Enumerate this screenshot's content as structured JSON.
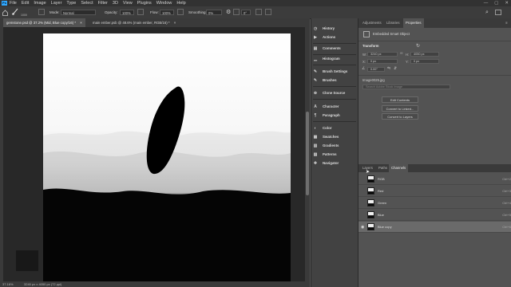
{
  "menubar": {
    "items": [
      "File",
      "Edit",
      "Image",
      "Layer",
      "Type",
      "Select",
      "Filter",
      "3D",
      "View",
      "Plugins",
      "Window",
      "Help"
    ],
    "minimize": "—",
    "maximize": "▢",
    "close": "✕"
  },
  "options": {
    "mode_label": "Mode:",
    "mode_value": "Normal",
    "opacity_label": "Opacity:",
    "opacity_value": "100%",
    "flow_label": "Flow:",
    "flow_value": "100%",
    "smoothing_label": "Smoothing:",
    "smoothing_value": "0%",
    "angle_value": "0°",
    "brush_size": "1000"
  },
  "tabs": [
    {
      "label": "gemstone.psd @ 37.2% (Mid, Blue copy/16) *",
      "close": "×"
    },
    {
      "label": "main ember.psb @ 48.6% (main ember, RGB/16) *",
      "close": "×"
    }
  ],
  "status": {
    "zoom": "37.16%",
    "size": "3240 px x 4050 px (72 ppi)"
  },
  "panel_strip": {
    "items": [
      "History",
      "Actions",
      "Comments",
      "Histogram",
      "Brush Settings",
      "Brushes",
      "Clone Source",
      "Character",
      "Paragraph",
      "Color",
      "Swatches",
      "Gradients",
      "Patterns",
      "Navigator"
    ]
  },
  "properties": {
    "tabs": [
      "Adjustments",
      "Libraries",
      "Properties"
    ],
    "layer_type": "Embedded Smart Object",
    "transform_label": "Transform",
    "w_label": "W:",
    "w_value": "3240 px",
    "h_label": "H:",
    "h_value": "4050 px",
    "x_label": "X:",
    "x_value": "0 px",
    "y_label": "Y:",
    "y_value": "0 px",
    "angle_value": "0.00°",
    "file_name": "Image0025.jpg",
    "search_placeholder": "Search Adobe Stock Image",
    "buttons": [
      "Edit Contents",
      "Convert to Linked...",
      "Convert to Layers"
    ]
  },
  "channels": {
    "tabs": [
      "Layers",
      "Paths",
      "Channels"
    ],
    "rows": [
      {
        "name": "RGB",
        "shortcut": "Ctrl+2"
      },
      {
        "name": "Red",
        "shortcut": "Ctrl+3"
      },
      {
        "name": "Green",
        "shortcut": "Ctrl+4"
      },
      {
        "name": "Blue",
        "shortcut": "Ctrl+5"
      },
      {
        "name": "Blue copy",
        "shortcut": "Ctrl+6"
      }
    ]
  },
  "colors": {
    "ps_accent": "#31a8ff",
    "canvas_bg": "#282828"
  }
}
